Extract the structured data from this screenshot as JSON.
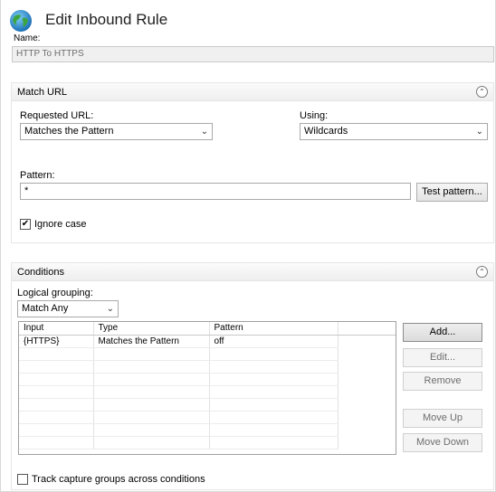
{
  "header": {
    "title": "Edit Inbound Rule"
  },
  "name": {
    "label": "Name:",
    "value": "HTTP To HTTPS"
  },
  "match_url": {
    "title": "Match URL",
    "collapse_icon": "chevron-up-icon",
    "requested_url": {
      "label": "Requested URL:",
      "value": "Matches the Pattern"
    },
    "using": {
      "label": "Using:",
      "value": "Wildcards"
    },
    "pattern": {
      "label": "Pattern:",
      "value": "*"
    },
    "test_button": "Test pattern...",
    "ignore_case": {
      "label": "Ignore case",
      "checked": true
    }
  },
  "conditions": {
    "title": "Conditions",
    "collapse_icon": "chevron-up-icon",
    "logical_grouping": {
      "label": "Logical grouping:",
      "value": "Match Any"
    },
    "columns": [
      "Input",
      "Type",
      "Pattern"
    ],
    "rows": [
      {
        "input": "{HTTPS}",
        "type": "Matches the Pattern",
        "pattern": "off"
      }
    ],
    "buttons": {
      "add": "Add...",
      "edit": "Edit...",
      "remove": "Remove",
      "move_up": "Move Up",
      "move_down": "Move Down"
    },
    "track_capture": {
      "label": "Track capture groups across conditions",
      "checked": false
    }
  }
}
